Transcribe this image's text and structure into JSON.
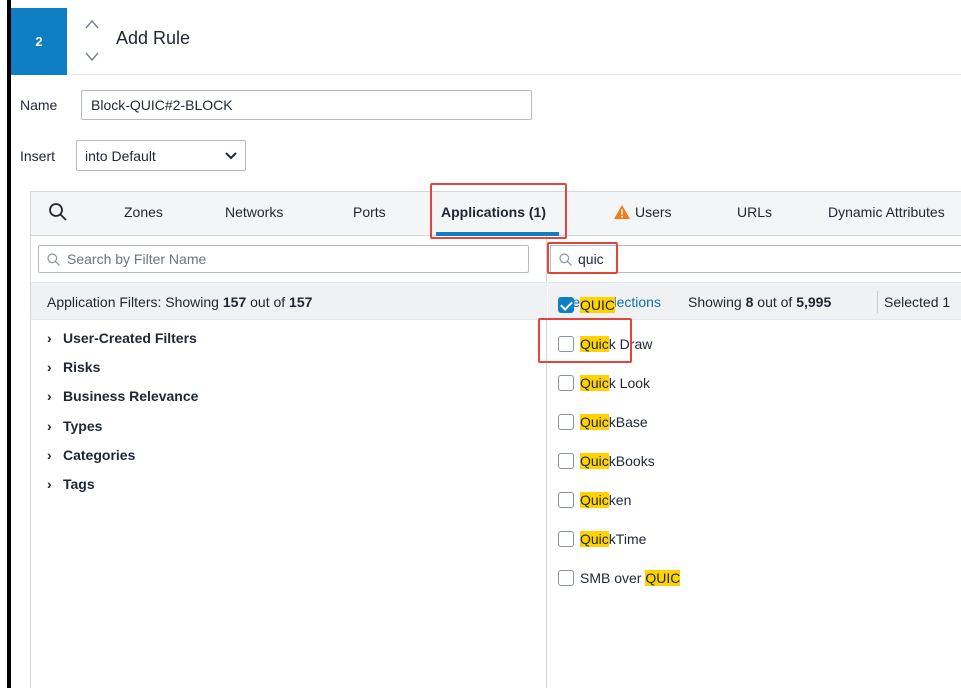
{
  "header": {
    "step": "2",
    "title": "Add Rule"
  },
  "form": {
    "name_label": "Name",
    "name_value": "Block-QUIC#2-BLOCK",
    "insert_label": "Insert",
    "insert_value": "into Default"
  },
  "tabs": [
    "Zones",
    "Networks",
    "Ports",
    "Applications (1)",
    "Users",
    "URLs",
    "Dynamic Attributes"
  ],
  "left": {
    "search_placeholder": "Search by Filter Name",
    "filters_prefix": "Application Filters: Showing ",
    "filters_count": "157",
    "filters_mid": " out of ",
    "filters_total": "157",
    "items": [
      "User-Created Filters",
      "Risks",
      "Business Relevance",
      "Types",
      "Categories",
      "Tags"
    ]
  },
  "right": {
    "search_value": "quic",
    "clear": "Clear Selections",
    "showing_prefix": "Showing ",
    "showing_count": "8",
    "showing_mid": " out of ",
    "showing_total": "5,995",
    "selected": "Selected 1",
    "apps": [
      {
        "pre": "",
        "hl": "QUIC",
        "post": "",
        "checked": true
      },
      {
        "pre": "",
        "hl": "Quic",
        "post": "k Draw",
        "checked": false
      },
      {
        "pre": "",
        "hl": "Quic",
        "post": "k Look",
        "checked": false
      },
      {
        "pre": "",
        "hl": "Quic",
        "post": "kBase",
        "checked": false
      },
      {
        "pre": "",
        "hl": "Quic",
        "post": "kBooks",
        "checked": false
      },
      {
        "pre": "",
        "hl": "Quic",
        "post": "ken",
        "checked": false
      },
      {
        "pre": "",
        "hl": "Quic",
        "post": "kTime",
        "checked": false
      },
      {
        "pre": "SMB over ",
        "hl": "QUIC",
        "post": "",
        "checked": false
      }
    ]
  },
  "colors": {
    "accent": "#0d7fc2",
    "highlight": "#ffd200",
    "annotation": "#e2453c",
    "warning": "#f07c1e"
  }
}
